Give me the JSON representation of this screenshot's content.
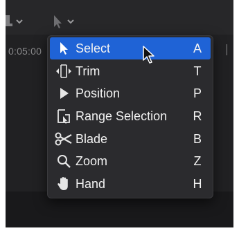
{
  "timeline": {
    "timecode": "0:05:00"
  },
  "menu": {
    "items": [
      {
        "label": "Select",
        "shortcut": "A",
        "icon": "arrow-icon"
      },
      {
        "label": "Trim",
        "shortcut": "T",
        "icon": "trim-icon"
      },
      {
        "label": "Position",
        "shortcut": "P",
        "icon": "position-icon"
      },
      {
        "label": "Range Selection",
        "shortcut": "R",
        "icon": "range-selection-icon"
      },
      {
        "label": "Blade",
        "shortcut": "B",
        "icon": "blade-icon"
      },
      {
        "label": "Zoom",
        "shortcut": "Z",
        "icon": "zoom-icon"
      },
      {
        "label": "Hand",
        "shortcut": "H",
        "icon": "hand-icon"
      }
    ],
    "selected_index": 0
  },
  "colors": {
    "highlight": "#1f63d6",
    "menu_bg": "#2b2b2e",
    "text": "#f2f2f2"
  }
}
